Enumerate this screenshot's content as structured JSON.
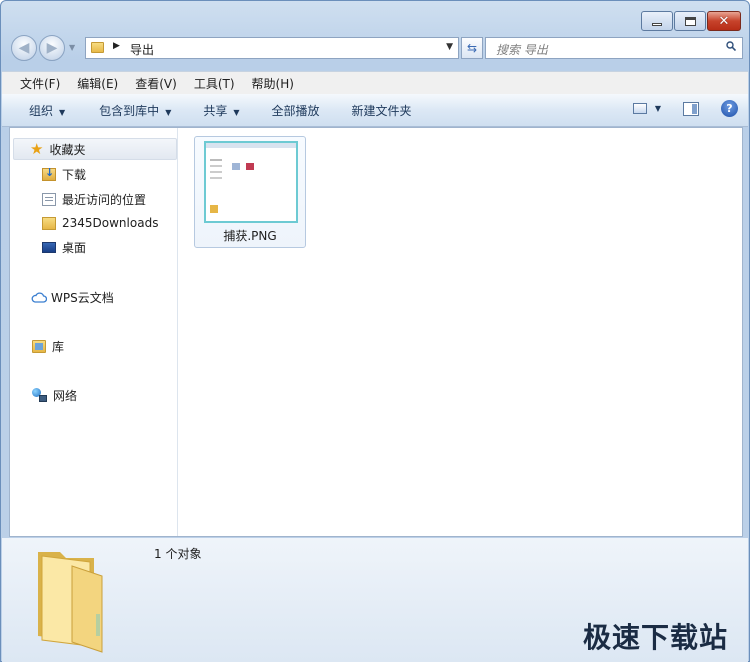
{
  "window": {
    "caption": {
      "minimize": "minimize",
      "maximize": "maximize",
      "close": "✕"
    }
  },
  "address": {
    "path_segment": "导出",
    "search_placeholder": "搜索 导出"
  },
  "menu": [
    "文件(F)",
    "编辑(E)",
    "查看(V)",
    "工具(T)",
    "帮助(H)"
  ],
  "commands": {
    "organize": "组织",
    "include_in_library": "包含到库中",
    "share": "共享",
    "play_all": "全部播放",
    "new_folder": "新建文件夹"
  },
  "sidebar": {
    "favorites": {
      "label": "收藏夹",
      "items": [
        "下载",
        "最近访问的位置",
        "2345Downloads",
        "桌面"
      ]
    },
    "wps_cloud": "WPS云文档",
    "library": "库",
    "network": "网络"
  },
  "files": [
    {
      "name": "捕获.PNG",
      "type": "png-thumbnail"
    }
  ],
  "details": {
    "count_text": "1 个对象"
  },
  "watermark": "极速下载站",
  "colors": {
    "chrome": "#bcd0e8",
    "accent": "#3a6ab4",
    "close_button": "#c7432b"
  }
}
